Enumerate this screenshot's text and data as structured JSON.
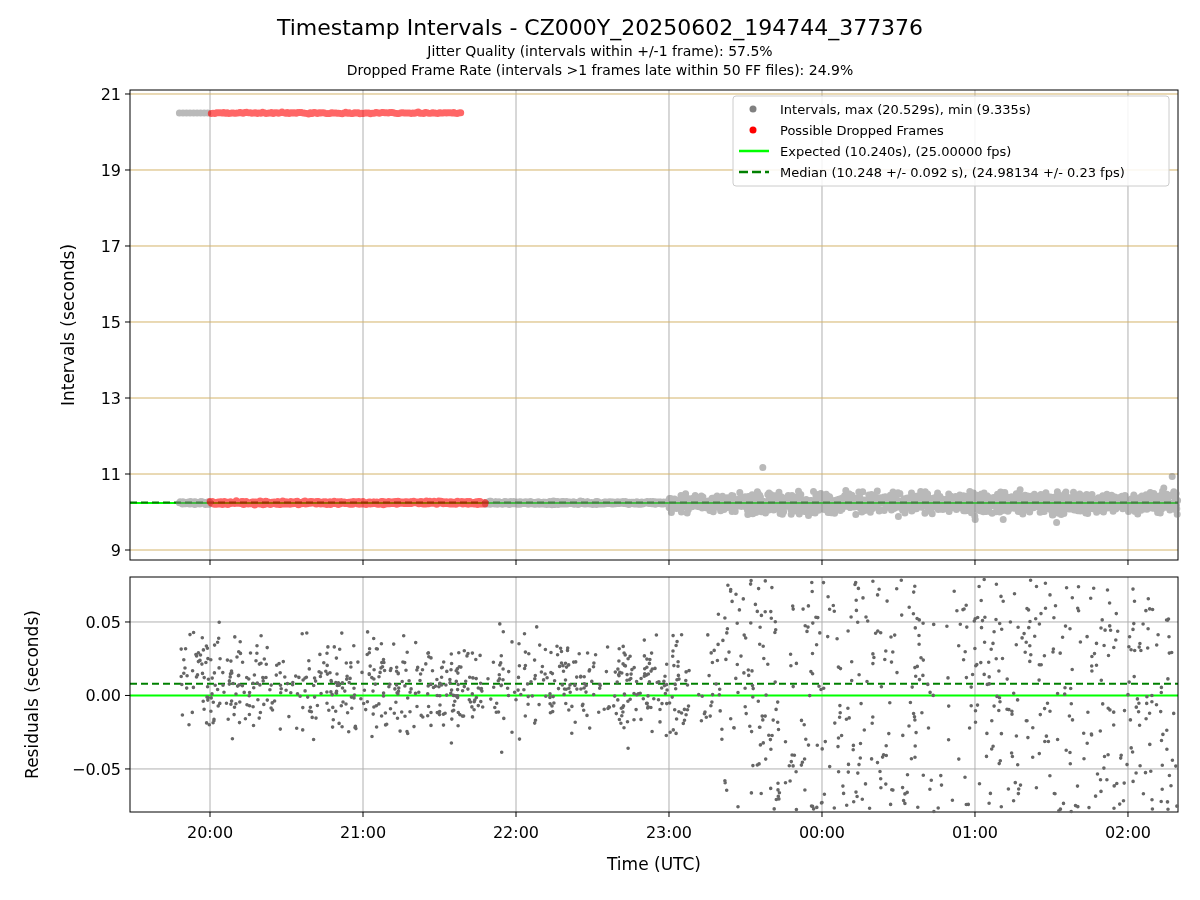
{
  "title": "Timestamp Intervals - CZ000Y_20250602_194744_377376",
  "subtitles": [
    "Jitter Quality (intervals within +/-1 frame): 57.5%",
    "Dropped Frame Rate (intervals >1 frames late within 50 FF files): 24.9%"
  ],
  "interval_chart": {
    "chart_data": {
      "type": "scatter",
      "ylabel": "Intervals (seconds)",
      "grid": true,
      "categories": [
        null,
        null,
        null,
        null,
        null,
        null,
        null
      ],
      "ylim": [
        8.737,
        21.105
      ],
      "yticks": [
        9,
        11,
        13,
        15,
        17,
        19,
        21
      ],
      "ref_lines": [
        {
          "axis": "y",
          "value": 10.24,
          "color": "#00ff00"
        },
        {
          "axis": "y",
          "value": 10.25,
          "color": "#008000"
        }
      ]
    },
    "legend": [
      {
        "kind": "dot",
        "color": "#808080",
        "label": "Intervals, max (20.529s), min (9.335s)"
      },
      {
        "kind": "dot",
        "color": "#ff0000",
        "label": "Possible Dropped Frames"
      },
      {
        "kind": "line",
        "color": "#00ff00",
        "label": "Expected (10.240s), (25.00000 fps)"
      },
      {
        "kind": "dashed",
        "color": "#008000",
        "label": "Median (10.248 +/- 0.092 s), (24.98134 +/- 0.23 fps)"
      }
    ]
  },
  "residual_chart": {
    "chart_data": {
      "type": "scatter",
      "xlabel": "Time (UTC)",
      "ylabel": "Residuals (seconds)",
      "grid": true,
      "ylim": [
        -0.0793,
        0.0806
      ],
      "categories": [
        "20:00",
        "21:00",
        "22:00",
        "23:00",
        "00:00",
        "01:00",
        "02:00"
      ],
      "yticks": [
        {
          "value": 0.05,
          "label": "0.05"
        },
        {
          "value": 0,
          "label": "0.00"
        },
        {
          "value": -0.05,
          "label": "−0.05"
        }
      ],
      "ref_lines": [
        {
          "axis": "y",
          "value": 0,
          "color": "#00ff00"
        },
        {
          "axis": "y",
          "value": 0.008,
          "color": "#008000"
        }
      ]
    }
  }
}
